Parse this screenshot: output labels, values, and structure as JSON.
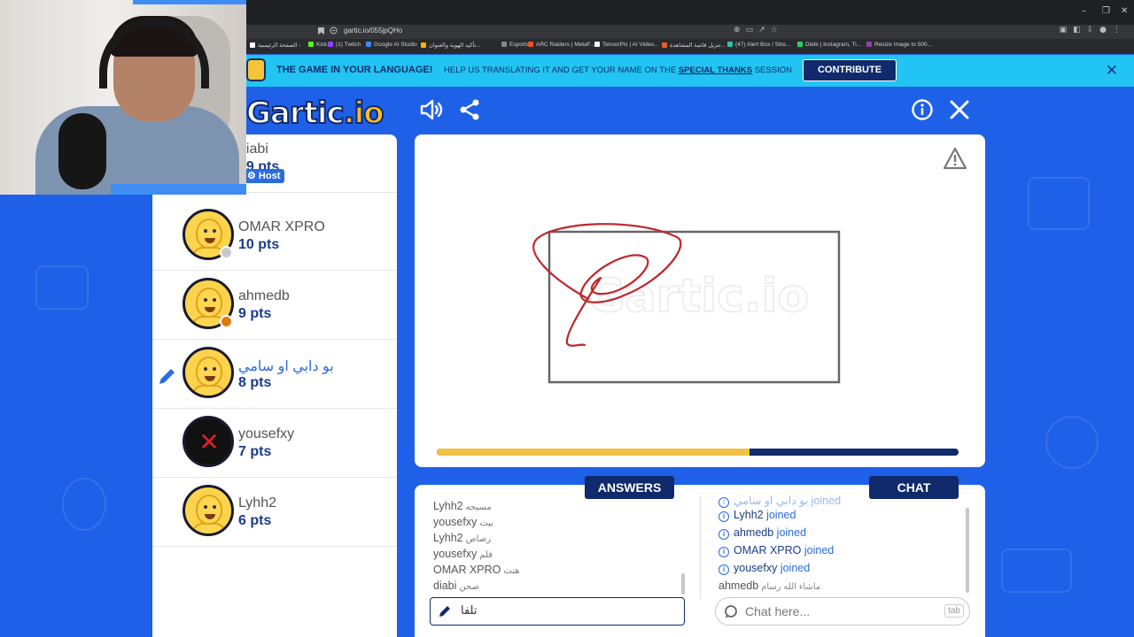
{
  "browser": {
    "url": "gartic.io/055jpQHo",
    "window_controls": [
      "–",
      "❐",
      "✕"
    ],
    "bookmarks": [
      {
        "label": "الصفحة الرئيسية -",
        "color": "#ffffff"
      },
      {
        "label": "Kick",
        "color": "#53fc18"
      },
      {
        "label": "(1) Twitch",
        "color": "#9146ff"
      },
      {
        "label": "Google AI Studio",
        "color": "#4285f4"
      },
      {
        "label": "تأكيد الهوية والعنوان...",
        "color": "#f5b301"
      },
      {
        "label": "Esports",
        "color": "#888888"
      },
      {
        "label": "ARC Raiders | MetaF...",
        "color": "#e5572b"
      },
      {
        "label": "TensorPix | AI Video...",
        "color": "#ffffff"
      },
      {
        "label": "تنزيل قائمة المشاهدة...",
        "color": "#f05a28"
      },
      {
        "label": "(47) Alert Box / Stre...",
        "color": "#31c3a2"
      },
      {
        "label": "Diebi | Instagram, Ti...",
        "color": "#25d366"
      },
      {
        "label": "Resize Image to 500...",
        "color": "#8e44ad"
      }
    ]
  },
  "banner": {
    "title": "THE GAME IN YOUR LANGUAGE!",
    "subtitle_prefix": "HELP US TRANSLATING IT AND GET YOUR NAME ON THE ",
    "subtitle_bold": "SPECIAL THANKS",
    "subtitle_suffix": " SESSION",
    "contribute_label": "CONTRIBUTE",
    "close_icon": "✕"
  },
  "header": {
    "logo_main": "Gartic",
    "logo_suffix": ".io"
  },
  "players": [
    {
      "name": "diabi",
      "points": "19 pts",
      "host": true,
      "host_label": "Host",
      "status_color": "",
      "drawing": false,
      "avatar": "smiley"
    },
    {
      "name": "OMAR XPRO",
      "points": "10 pts",
      "host": false,
      "status_color": "#c8c8c8",
      "drawing": false,
      "avatar": "smiley"
    },
    {
      "name": "ahmedb",
      "points": "9 pts",
      "host": false,
      "status_color": "#e07a12",
      "drawing": false,
      "avatar": "smiley"
    },
    {
      "name": "بو دابي او سامي",
      "points": "8 pts",
      "host": false,
      "status_color": "",
      "drawing": true,
      "avatar": "smiley"
    },
    {
      "name": "yousefxy",
      "points": "7 pts",
      "host": false,
      "status_color": "",
      "drawing": false,
      "avatar": "xlogo"
    },
    {
      "name": "Lyhh2",
      "points": "6 pts",
      "host": false,
      "status_color": "",
      "drawing": false,
      "avatar": "smiley"
    }
  ],
  "board": {
    "timer_progress": 0.6,
    "colors": {
      "ink": "#c0262b",
      "frame": "#666666",
      "timer_fill": "#f1c343",
      "timer_track": "#102a6b"
    }
  },
  "answers": {
    "tab_label": "ANSWERS",
    "messages": [
      {
        "who": "Lyhh2",
        "text": "مسبحه"
      },
      {
        "who": "yousefxy",
        "text": "بيت"
      },
      {
        "who": "Lyhh2",
        "text": "رصاص"
      },
      {
        "who": "yousefxy",
        "text": "قلم"
      },
      {
        "who": "OMAR XPRO",
        "text": "هنت"
      },
      {
        "who": "diabi",
        "text": "صحن"
      }
    ],
    "input_value": "تلفا"
  },
  "chat": {
    "tab_label": "CHAT",
    "partial_top": "بو دابي او سامي joined",
    "joined_suffix": "joined",
    "joined": [
      "Lyhh2",
      "ahmedb",
      "OMAR XPRO",
      "yousefxy"
    ],
    "last_message": {
      "who": "ahmedb",
      "text": "ماشاء الله رسام"
    },
    "placeholder": "Chat here...",
    "tab_hint": "tab"
  }
}
